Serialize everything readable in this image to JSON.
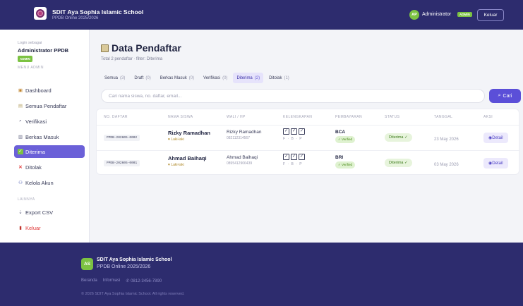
{
  "header": {
    "school_name": "SDIT Aya Sophia Islamic School",
    "subtitle": "PPDB Online 2025/2026",
    "avatar_initials": "AP",
    "user_name": "Administrator",
    "role_badge": "ADMIN",
    "logout_label": "Keluar"
  },
  "sidebar": {
    "login_as": "Login sebagai",
    "admin_name": "Administrator PPDB",
    "admin_badge": "ADMIN",
    "menu_title": "MENU ADMIN",
    "other_title": "LAINNYA",
    "items": [
      {
        "label": "Dashboard",
        "icon": "dashboard-icon"
      },
      {
        "label": "Semua Pendaftar",
        "icon": "list-icon"
      },
      {
        "label": "Verifikasi",
        "icon": "search-icon"
      },
      {
        "label": "Berkas Masuk",
        "icon": "folder-icon"
      },
      {
        "label": "Diterima",
        "icon": "check-icon"
      },
      {
        "label": "Ditolak",
        "icon": "cross-icon"
      },
      {
        "label": "Kelola Akun",
        "icon": "users-icon"
      }
    ],
    "other_items": [
      {
        "label": "Export CSV",
        "icon": "export-icon"
      },
      {
        "label": "Keluar",
        "icon": "logout-icon"
      }
    ]
  },
  "main": {
    "title": "Data Pendaftar",
    "subtitle": "Total 2 pendaftar · filter: Diterima",
    "tabs": [
      {
        "label": "Semua",
        "count": "(3)"
      },
      {
        "label": "Draft",
        "count": "(0)"
      },
      {
        "label": "Berkas Masuk",
        "count": "(0)"
      },
      {
        "label": "Verifikasi",
        "count": "(0)"
      },
      {
        "label": "Diterima",
        "count": "(2)"
      },
      {
        "label": "Ditolak",
        "count": "(1)"
      }
    ],
    "search_placeholder": "Cari nama siswa, no. daftar, email...",
    "search_button": "Cari",
    "columns": [
      "NO. DAFTAR",
      "NAMA SISWA",
      "WALI / HP",
      "KELENGKAPAN",
      "PEMBAYARAN",
      "STATUS",
      "TANGGAL",
      "AKSI"
    ],
    "rows": [
      {
        "no": "PPDB-202605-0002",
        "name": "Rizky Ramadhan",
        "gender": "Laki-laki",
        "wali": "Rizky Ramadhan",
        "hp": "082112314567",
        "kelengkapan": "F · B · P",
        "bank": "BCA",
        "payment_status": "✓ Verified",
        "status": "Diterima ✓",
        "date": "23 May 2026",
        "action": "Detail"
      },
      {
        "no": "PPDB-202605-0001",
        "name": "Ahmad Baihaqi",
        "gender": "Laki-laki",
        "wali": "Ahmad Baihaqi",
        "hp": "0895412906439",
        "kelengkapan": "F · B · P",
        "bank": "BRI",
        "payment_status": "✓ Verified",
        "status": "Diterima ✓",
        "date": "03 May 2026",
        "action": "Detail"
      }
    ]
  },
  "footer": {
    "logo_initials": "AS",
    "school_name": "SDIT Aya Sophia Islamic School",
    "subtitle": "PPDB Online 2025/2026",
    "links": [
      "Beranda",
      "Informasi",
      "0812-3456-7890"
    ],
    "copyright": "© 2026 SDIT Aya Sophia Islamic School. All rights reserved."
  }
}
